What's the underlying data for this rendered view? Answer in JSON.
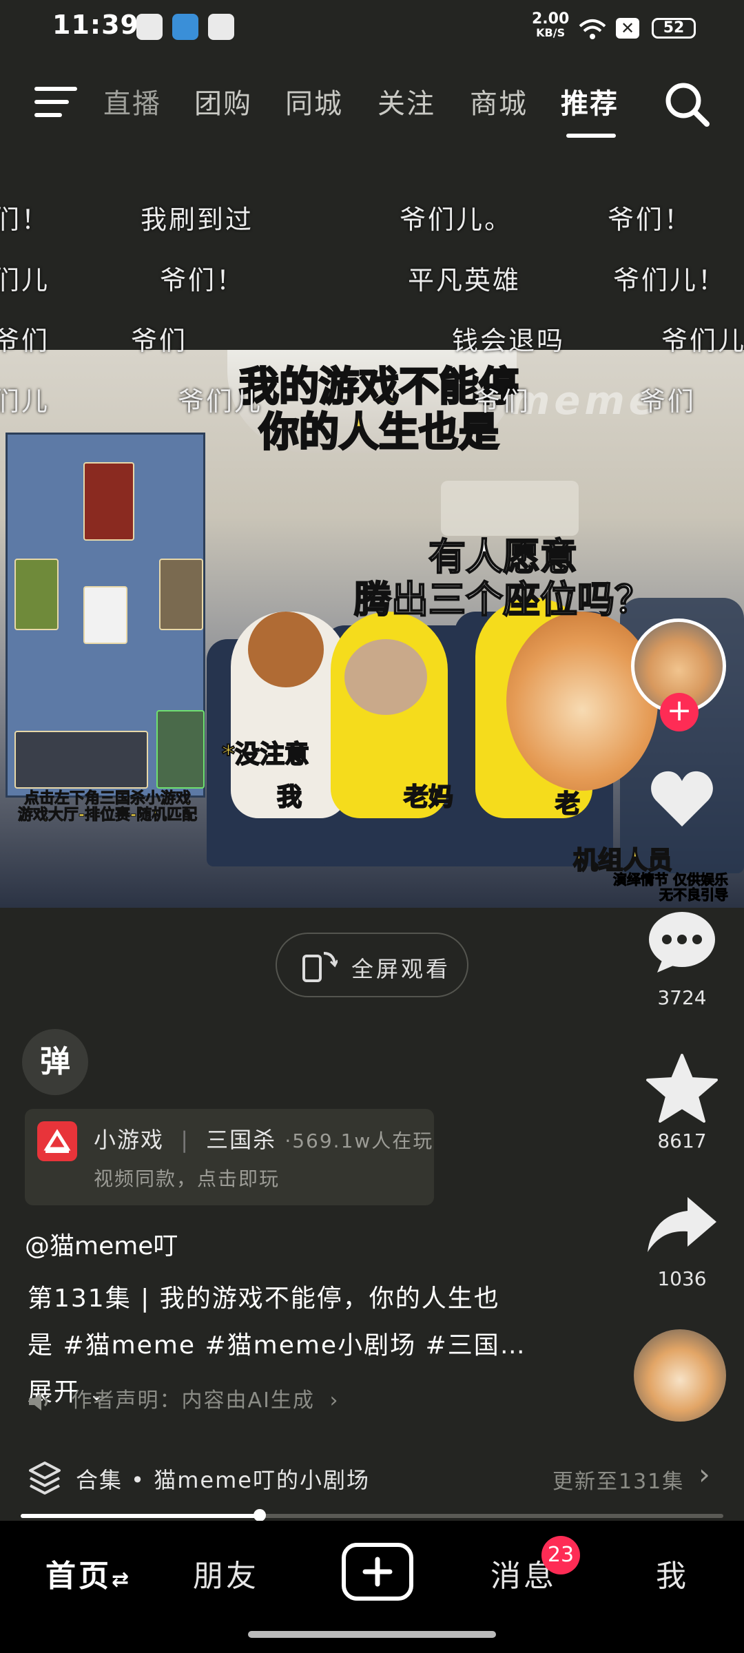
{
  "status_bar": {
    "time": "11:39",
    "speed_value": "2.00",
    "speed_unit": "KB/S",
    "battery": "52"
  },
  "top_nav": {
    "tabs": [
      "直播",
      "团购",
      "同城",
      "关注",
      "商城",
      "推荐"
    ],
    "active_tab": "推荐"
  },
  "danmaku": [
    "们！",
    "我刷到过",
    "爷们儿。",
    "爷们！",
    "们儿",
    "爷们！",
    "平凡英雄",
    "爷们儿！",
    "爷们",
    "爷们",
    "钱会退吗",
    "爷们儿",
    "们儿",
    "爷们儿",
    "爷们",
    "爷们"
  ],
  "video": {
    "caption_top": [
      "我的游戏不能停",
      "你的人生也是"
    ],
    "caption_mid": [
      "有人愿意",
      "腾出三个座位吗？"
    ],
    "label_dog": "*没注意",
    "label_me": "我",
    "label_mom": "老妈",
    "label_lao": "老",
    "label_crew": "机组人员",
    "disclaimer": [
      "演绎情节 仅供娱乐",
      "无不良引导"
    ],
    "game_hint": [
      "点击左下角三国杀小游戏",
      "游戏大厅-排位赛-随机匹配"
    ],
    "watermark": "meme"
  },
  "actions": {
    "comments": "3724",
    "favorites": "8617",
    "shares": "1036"
  },
  "fullscreen_label": "全屏观看",
  "danmu_button": "弹",
  "game_card": {
    "type": "小游戏",
    "separator": "|",
    "name": "三国杀",
    "players": "·569.1w人在玩",
    "sub": "视频同款，点击即玩"
  },
  "author": "@猫meme叮",
  "description": {
    "line1": "第131集 | 我的游戏不能停，你的人生也",
    "line2": "是 #猫meme #猫meme小剧场 #三国…",
    "expand": "展开"
  },
  "ai_note": "作者声明：内容由AI生成",
  "collection": {
    "prefix": "合集 • ",
    "title": "猫meme叮的小剧场",
    "update": "更新至131集"
  },
  "progress": 0.34,
  "bottom_nav": {
    "home": "首页",
    "friends": "朋友",
    "messages": "消息",
    "messages_badge": "23",
    "me": "我"
  },
  "colors": {
    "accent": "#fe2c55",
    "background": "#242522",
    "caption_yellow": "#ffe24a"
  }
}
